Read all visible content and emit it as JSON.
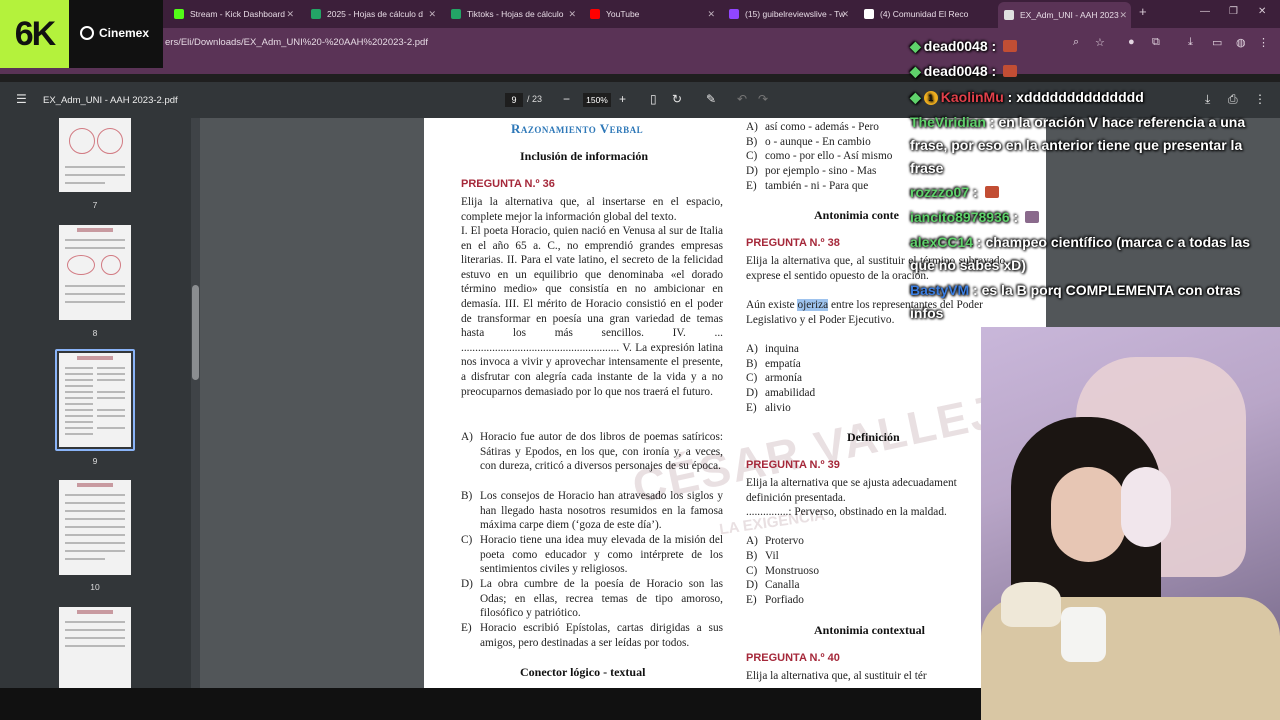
{
  "browser": {
    "tabs": [
      {
        "label": "Stream - Kick Dashboard",
        "color": "#53fc18"
      },
      {
        "label": "2025 - Hojas de cálculo d",
        "color": "#23a566"
      },
      {
        "label": "Tiktoks - Hojas de cálculo",
        "color": "#23a566"
      },
      {
        "label": "YouTube",
        "color": "#ff0000"
      },
      {
        "label": "(15) guibelreviewslive - Tw",
        "color": "#9146ff"
      },
      {
        "label": "(4) Comunidad El Reco",
        "color": "#ffffff"
      },
      {
        "label": "EX_Adm_UNI - AAH 2023",
        "color": "#e0e0e0"
      }
    ],
    "url": "ers/Eli/Downloads/EX_Adm_UNI%20-%20AAH%202023-2.pdf"
  },
  "overlay_logo": {
    "mark": "6K",
    "brand": "Cinemex"
  },
  "pdf": {
    "title": "EX_Adm_UNI - AAH 2023-2.pdf",
    "page_current": "9",
    "page_total": "/ 23",
    "zoom": "150%",
    "thumbnails": [
      {
        "label": "7",
        "top": 0
      },
      {
        "label": "8",
        "top": 0
      },
      {
        "label": "9",
        "top": 0
      },
      {
        "label": "10",
        "top": 0
      }
    ]
  },
  "doc": {
    "section_title": "Razonamiento Verbal",
    "left": {
      "subheading": "Inclusión de información",
      "q36_title": "PREGUNTA N.º 36",
      "q36_prompt": "Elija la alternativa que, al insertarse en el espacio, complete mejor la información global del texto.",
      "q36_text": "I. El poeta Horacio, quien nació en Venusa al sur de Italia en el año 65 a. C., no emprendió grandes empresas literarias. II. Para el vate latino, el secreto de la felicidad estuvo en un equilibrio que denominaba «el dorado término medio» que consistía en no ambicionar en demasía. III. El mérito de Horacio consistió en el poder de transformar en poesía una gran variedad de temas hasta los más sencillos. IV. ... ........................................................ V. La expresión latina nos invoca a vivir y aprovechar intensamente el presente, a disfrutar con alegría cada instante de la vida y a no preocuparnos demasiado por lo que nos traerá el futuro.",
      "q36_options": [
        {
          "k": "A)",
          "t": "Horacio fue autor de dos libros de poemas satíricos: Sátiras y Epodos, en los que, con ironía y, a veces, con dureza, criticó a diversos personajes de su época."
        },
        {
          "k": "B)",
          "t": "Los consejos de Horacio han atravesado los siglos y han llegado hasta nosotros resumidos en la famosa máxima carpe diem (‘goza de este día’)."
        },
        {
          "k": "C)",
          "t": "Horacio tiene una idea muy elevada de la misión del poeta como educador y como intérprete de los sentimientos civiles y religiosos."
        },
        {
          "k": "D)",
          "t": "La obra cumbre de la poesía de Horacio son las Odas; en ellas, recrea temas de tipo amoroso, filosófico y patriótico."
        },
        {
          "k": "E)",
          "t": "Horacio escribió Epístolas, cartas dirigidas a sus amigos, pero destinadas a ser leídas por todos."
        }
      ],
      "bottom_heading": "Conector lógico - textual"
    },
    "right": {
      "connector_options": [
        {
          "k": "A)",
          "t": "así como - además - Pero"
        },
        {
          "k": "B)",
          "t": "o - aunque - En cambio"
        },
        {
          "k": "C)",
          "t": "como - por ello - Así mismo"
        },
        {
          "k": "D)",
          "t": "por ejemplo - sino - Mas"
        },
        {
          "k": "E)",
          "t": "también - ni - Para que"
        }
      ],
      "antonimia_heading": "Antonimia conte",
      "q38_title": "PREGUNTA N.º 38",
      "q38_prompt": "Elija la alternativa que, al sustituir el término subrayado, exprese el sentido opuesto de la oración.",
      "q38_sentence_pre": "Aún existe ",
      "q38_sentence_hl": "ojeriza",
      "q38_sentence_post": " entre los representantes del Poder Legislativo y el Poder Ejecutivo.",
      "q38_options": [
        {
          "k": "A)",
          "t": "inquina"
        },
        {
          "k": "B)",
          "t": "empatía"
        },
        {
          "k": "C)",
          "t": "armonía"
        },
        {
          "k": "D)",
          "t": "amabilidad"
        },
        {
          "k": "E)",
          "t": "alivio"
        }
      ],
      "definicion_heading": "Definición",
      "q39_title": "PREGUNTA N.º 39",
      "q39_prompt": "Elija la alternativa que se ajusta adecuadament definición presentada.",
      "q39_def": "...............: Perverso, obstinado en la maldad.",
      "q39_options": [
        {
          "k": "A)",
          "t": "Protervo"
        },
        {
          "k": "B)",
          "t": "Vil"
        },
        {
          "k": "C)",
          "t": "Monstruoso"
        },
        {
          "k": "D)",
          "t": "Canalla"
        },
        {
          "k": "E)",
          "t": "Porfiado"
        }
      ],
      "antonimia2_heading": "Antonimia contextual",
      "q40_title": "PREGUNTA N.º 40",
      "q40_prompt": "Elija la alternativa que, al sustituir el tér"
    },
    "watermark": "CÉSAR VALLEJO",
    "watermark_sub": "LA EXIGENCIA"
  },
  "chat": [
    {
      "user": "dead0048",
      "color": "#ffffff",
      "text": "",
      "badge": "gem"
    },
    {
      "user": "dead0048",
      "color": "#ffffff",
      "text": "",
      "badge": "gem"
    },
    {
      "user": "KaolinMu",
      "color": "#e0404a",
      "text": "xdddddddddddddd",
      "badge": "gem-1"
    },
    {
      "user": "TheViridian",
      "color": "#5fd26b",
      "text": "en la oración V hace referencia a una frase, por eso en la anterior tiene que presentar la frase"
    },
    {
      "user": "rozzzo07",
      "color": "#5fd26b",
      "text": ""
    },
    {
      "user": "iancito8978936",
      "color": "#5fd26b",
      "text": ""
    },
    {
      "user": "alexCC14",
      "color": "#5fd26b",
      "text": "champeo científico (marca c a todas las que no sabes xD)"
    },
    {
      "user": "BastyVM",
      "color": "#3a7de0",
      "text": "es la B porq COMPLEMENTA con otras infos"
    }
  ]
}
